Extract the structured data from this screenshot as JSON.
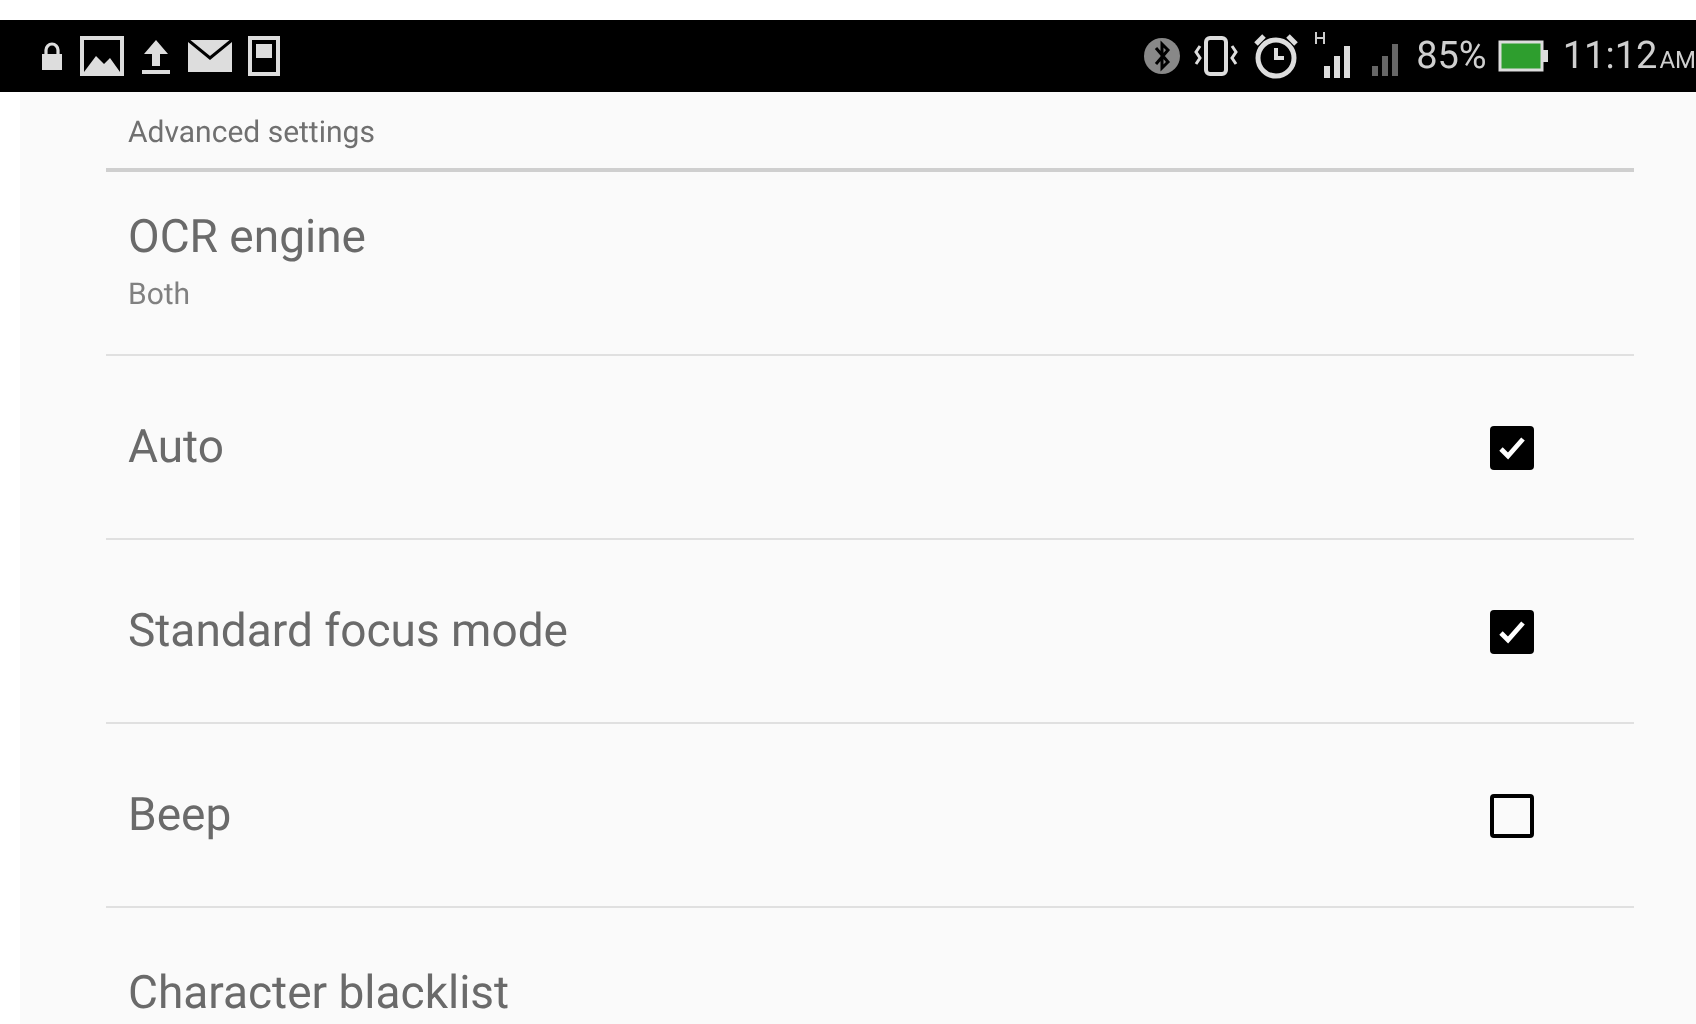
{
  "status_bar": {
    "battery_text": "85%",
    "time": "11:12",
    "am_pm": "AM"
  },
  "section_header": "Advanced settings",
  "settings": [
    {
      "kind": "list",
      "title": "OCR engine",
      "summary": "Both"
    },
    {
      "kind": "checkbox",
      "title": "Auto",
      "checked": true
    },
    {
      "kind": "checkbox",
      "title": "Standard focus mode",
      "checked": true
    },
    {
      "kind": "checkbox",
      "title": "Beep",
      "checked": false
    },
    {
      "kind": "text",
      "title": "Character blacklist"
    }
  ]
}
